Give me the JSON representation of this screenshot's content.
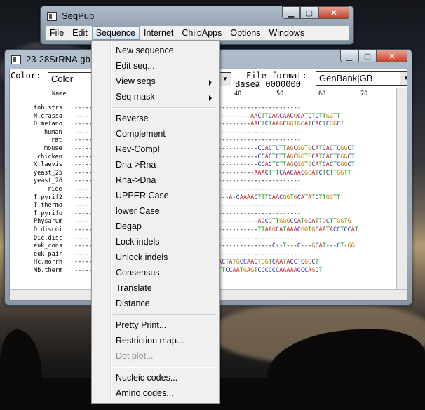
{
  "main_window": {
    "title": "SeqPup",
    "menus": [
      "File",
      "Edit",
      "Sequence",
      "Internet",
      "ChildApps",
      "Options",
      "Windows"
    ],
    "active_menu": "Sequence"
  },
  "doc_window": {
    "title": "23-28SrRNA.gb",
    "color_label": "Color:",
    "color_value": "Color",
    "file_format_label": "File format:",
    "file_format_value": "GenBank|GB",
    "base_label": "Base# 0000000",
    "name_header": "Name",
    "ruler_ticks": [
      "40",
      "50",
      "60",
      "70",
      "8"
    ],
    "rows": [
      {
        "name": "tob.strs",
        "seq": "---------------------------------------------------------------"
      },
      {
        "name": "N.crassa",
        "seq": "-------------------------------------------------AACTTCAACAACGCATCTCTTGGTT"
      },
      {
        "name": "D.melano",
        "seq": "-------------------------------------------------AACTCTAAGCGGTGCATCACTCGGCT"
      },
      {
        "name": "human",
        "seq": "---------------------------------------------------------------"
      },
      {
        "name": "rat",
        "seq": "---------------------------------------------------------------"
      },
      {
        "name": "mouse",
        "seq": "---------------------------------------------------CCACTCTTAGCGGTGCATCACTCGGCT"
      },
      {
        "name": "chicken",
        "seq": "---------------------------------------------------CCACTCTTAGCGGTGCATCACTCGGCT"
      },
      {
        "name": "X.laevis",
        "seq": "---------------------------------------------------CCACTCTTAGCGGTGCATCACTCGGCT"
      },
      {
        "name": "yeast_25",
        "seq": "--------------------------------------------------AAACTTTCAACAACGGATCTCTTGGTT"
      },
      {
        "name": "yeast_26",
        "seq": "---------------------------------------------------------------"
      },
      {
        "name": "rice",
        "seq": "---------------------------------------------------------------"
      },
      {
        "name": "T.pyrif2",
        "seq": "-------------------------------------------A-CAAAACTTTCAACGGTGCATATCTTGGTT"
      },
      {
        "name": "T.thermo",
        "seq": "---------------------------------------------------------------"
      },
      {
        "name": "T.pyrifo",
        "seq": "---------------------------------------------------------------"
      },
      {
        "name": "Physarum",
        "seq": "---------------------------------------------------ACCGTTGGGCCATGCATTGCTTGGTG"
      },
      {
        "name": "D.discoi",
        "seq": "---------------------------------------------------TTAAGCATAAACGGTGCAATACCTCCAT"
      },
      {
        "name": "Dic.disc",
        "seq": "---------------------------------------------------------------"
      },
      {
        "name": "euk_cons",
        "seq": "-------------------------------------------------------C--T---C---GCAT---CT-GG"
      },
      {
        "name": "euk_pair",
        "seq": "---------------------------------------------------------------"
      },
      {
        "name": "Hc.morrh",
        "seq": "-----------------------------------GGC-TACTATGCCAACTGGTCAATACCTCGGCT"
      },
      {
        "name": "Mb.therm",
        "seq": "-----------------------------------CTC-TTTCCAATGAGTCCCCCCAAAAACCCAGCT"
      }
    ]
  },
  "sequence_menu": {
    "items": [
      {
        "label": "New sequence",
        "submenu": false,
        "disabled": false
      },
      {
        "label": "Edit seq...",
        "submenu": false,
        "disabled": false
      },
      {
        "label": "View seqs",
        "submenu": true,
        "disabled": false
      },
      {
        "label": "Seq mask",
        "submenu": true,
        "disabled": false
      },
      {
        "label": "Reverse",
        "submenu": false,
        "disabled": false
      },
      {
        "label": "Complement",
        "submenu": false,
        "disabled": false
      },
      {
        "label": "Rev-Compl",
        "submenu": false,
        "disabled": false
      },
      {
        "label": "Dna->Rna",
        "submenu": false,
        "disabled": false
      },
      {
        "label": "Rna->Dna",
        "submenu": false,
        "disabled": false
      },
      {
        "label": "UPPER Case",
        "submenu": false,
        "disabled": false
      },
      {
        "label": "lower Case",
        "submenu": false,
        "disabled": false
      },
      {
        "label": "Degap",
        "submenu": false,
        "disabled": false
      },
      {
        "label": "Lock indels",
        "submenu": false,
        "disabled": false
      },
      {
        "label": "Unlock indels",
        "submenu": false,
        "disabled": false
      },
      {
        "label": "Consensus",
        "submenu": false,
        "disabled": false
      },
      {
        "label": "Translate",
        "submenu": false,
        "disabled": false
      },
      {
        "label": "Distance",
        "submenu": false,
        "disabled": false
      },
      {
        "label": "Pretty Print...",
        "submenu": false,
        "disabled": false
      },
      {
        "label": "Restriction map...",
        "submenu": false,
        "disabled": false
      },
      {
        "label": "Dot plot...",
        "submenu": false,
        "disabled": true
      },
      {
        "label": "Nucleic codes...",
        "submenu": false,
        "disabled": false
      },
      {
        "label": "Amino codes...",
        "submenu": false,
        "disabled": false
      }
    ]
  },
  "colors": {
    "A": "#d02020",
    "C": "#2020d0",
    "G": "#d08000",
    "T": "#10a010"
  },
  "icons": {
    "minimize": "minimize-icon",
    "maximize": "maximize-icon",
    "close": "close-icon",
    "submenu": "chevron-right-icon"
  }
}
